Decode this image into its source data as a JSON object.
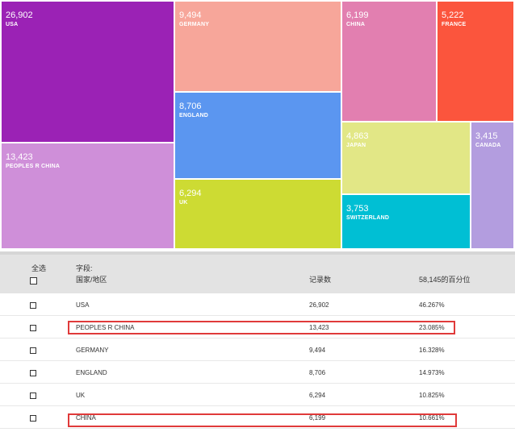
{
  "treemap": {
    "tiles": [
      {
        "value": "26,902",
        "label": "USA",
        "color": "#9b22b5"
      },
      {
        "value": "13,423",
        "label": "PEOPLES R CHINA",
        "color": "#cf8fd9"
      },
      {
        "value": "9,494",
        "label": "GERMANY",
        "color": "#f7a69a"
      },
      {
        "value": "8,706",
        "label": "ENGLAND",
        "color": "#5b96f0"
      },
      {
        "value": "6,294",
        "label": "UK",
        "color": "#cddb33"
      },
      {
        "value": "6,199",
        "label": "CHINA",
        "color": "#e27fb0"
      },
      {
        "value": "5,222",
        "label": "FRANCE",
        "color": "#fb553d"
      },
      {
        "value": "4,863",
        "label": "JAPAN",
        "color": "#e2e786"
      },
      {
        "value": "3,753",
        "label": "SWITZERLAND",
        "color": "#00bfd4"
      },
      {
        "value": "3,415",
        "label": "CANADA",
        "color": "#b39ddf"
      }
    ]
  },
  "table": {
    "header": {
      "select_all": "全选",
      "field_line1": "字段:",
      "field_line2": "国家/地区",
      "records": "记录数",
      "percent": "58,145的百分位"
    },
    "rows": [
      {
        "name": "USA",
        "count": "26,902",
        "pct": "46.267%"
      },
      {
        "name": "PEOPLES R CHINA",
        "count": "13,423",
        "pct": "23.085%"
      },
      {
        "name": "GERMANY",
        "count": "9,494",
        "pct": "16.328%"
      },
      {
        "name": "ENGLAND",
        "count": "8,706",
        "pct": "14.973%"
      },
      {
        "name": "UK",
        "count": "6,294",
        "pct": "10.825%"
      },
      {
        "name": "CHINA",
        "count": "6,199",
        "pct": "10.661%"
      }
    ]
  }
}
